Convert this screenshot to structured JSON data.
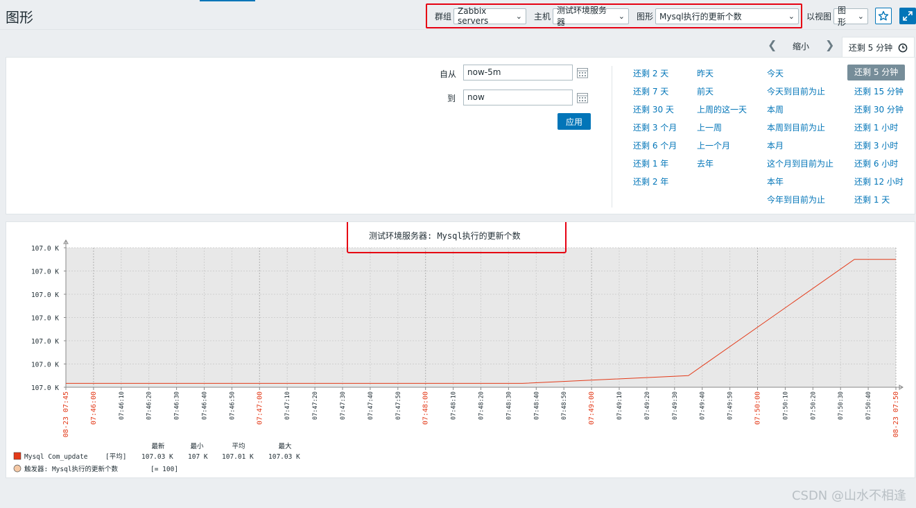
{
  "page": {
    "title": "图形"
  },
  "filters": {
    "group_label": "群组",
    "group_value": "Zabbix servers",
    "host_label": "主机",
    "host_value": "测试环境服务器",
    "graph_label": "图形",
    "graph_value": "Mysql执行的更新个数",
    "view_label": "以视图",
    "view_value": "图形"
  },
  "icons": {
    "favorite": "star-icon",
    "fullscreen": "fullscreen-icon",
    "prev": "chevron-left-icon",
    "next": "chevron-right-icon",
    "clock": "clock-icon",
    "calendar": "calendar-icon"
  },
  "timebar": {
    "zoom_out": "缩小",
    "current_tab": "还剩 5 分钟"
  },
  "time_form": {
    "from_label": "自从",
    "from_value": "now-5m",
    "to_label": "到",
    "to_value": "now",
    "apply_label": "应用"
  },
  "quick_ranges": [
    [
      "还剩 2 天",
      "还剩 7 天",
      "还剩 30 天",
      "还剩 3 个月",
      "还剩 6 个月",
      "还剩 1 年",
      "还剩 2 年"
    ],
    [
      "昨天",
      "前天",
      "上周的这一天",
      "上一周",
      "上一个月",
      "去年"
    ],
    [
      "今天",
      "今天到目前为止",
      "本周",
      "本周到目前为止",
      "本月",
      "这个月到目前为止",
      "本年",
      "今年到目前为止"
    ],
    [
      "还剩 5 分钟",
      "还剩 15 分钟",
      "还剩 30 分钟",
      "还剩 1 小时",
      "还剩 3 小时",
      "还剩 6 小时",
      "还剩 12 小时",
      "还剩 1 天"
    ]
  ],
  "selected_range": "还剩 5 分钟",
  "colors": {
    "accent": "#0275b8",
    "series": "#e33a19",
    "highlight_box": "#e60012",
    "major_tick": "#e33a19"
  },
  "chart_data": {
    "type": "line",
    "title": "测试环境服务器: Mysql执行的更新个数",
    "y_tick_labels": [
      "107.0 K",
      "107.0 K",
      "107.0 K",
      "107.0 K",
      "107.0 K",
      "107.0 K",
      "107.0 K"
    ],
    "x_tick_labels": [
      "08-23 07:45",
      "07:46:00",
      "07:46:10",
      "07:46:20",
      "07:46:30",
      "07:46:40",
      "07:46:50",
      "07:47:00",
      "07:47:10",
      "07:47:20",
      "07:47:30",
      "07:47:40",
      "07:47:50",
      "07:48:00",
      "07:48:10",
      "07:48:20",
      "07:48:30",
      "07:48:40",
      "07:48:50",
      "07:49:00",
      "07:49:10",
      "07:49:20",
      "07:49:30",
      "07:49:40",
      "07:49:50",
      "07:50:00",
      "07:50:10",
      "07:50:20",
      "07:50:30",
      "07:50:40",
      "08-23 07:50"
    ],
    "major_ticks": [
      "08-23 07:45",
      "07:46:00",
      "07:47:00",
      "07:48:00",
      "07:49:00",
      "07:50:00",
      "08-23 07:50"
    ],
    "grid": true,
    "x_unit": "seconds since 07:45:00",
    "xlim": [
      0,
      300
    ],
    "ylim": [
      107000,
      107036
    ],
    "series": [
      {
        "name": "Mysql Com_update",
        "x": [
          0,
          165,
          225,
          285,
          300
        ],
        "y": [
          107001,
          107001,
          107003,
          107033,
          107033
        ]
      }
    ],
    "legend": {
      "headers": [
        "最新",
        "最小",
        "平均",
        "最大"
      ],
      "series_row": {
        "name": "Mysql Com_update",
        "func": "[平均]",
        "last": "107.03 K",
        "min": "107 K",
        "avg": "107.01 K",
        "max": "107.03 K"
      },
      "trigger_row": {
        "text": "触发器: Mysql执行的更新个数",
        "value": "[= 100]"
      }
    }
  },
  "watermark": "CSDN @山水不相逢"
}
